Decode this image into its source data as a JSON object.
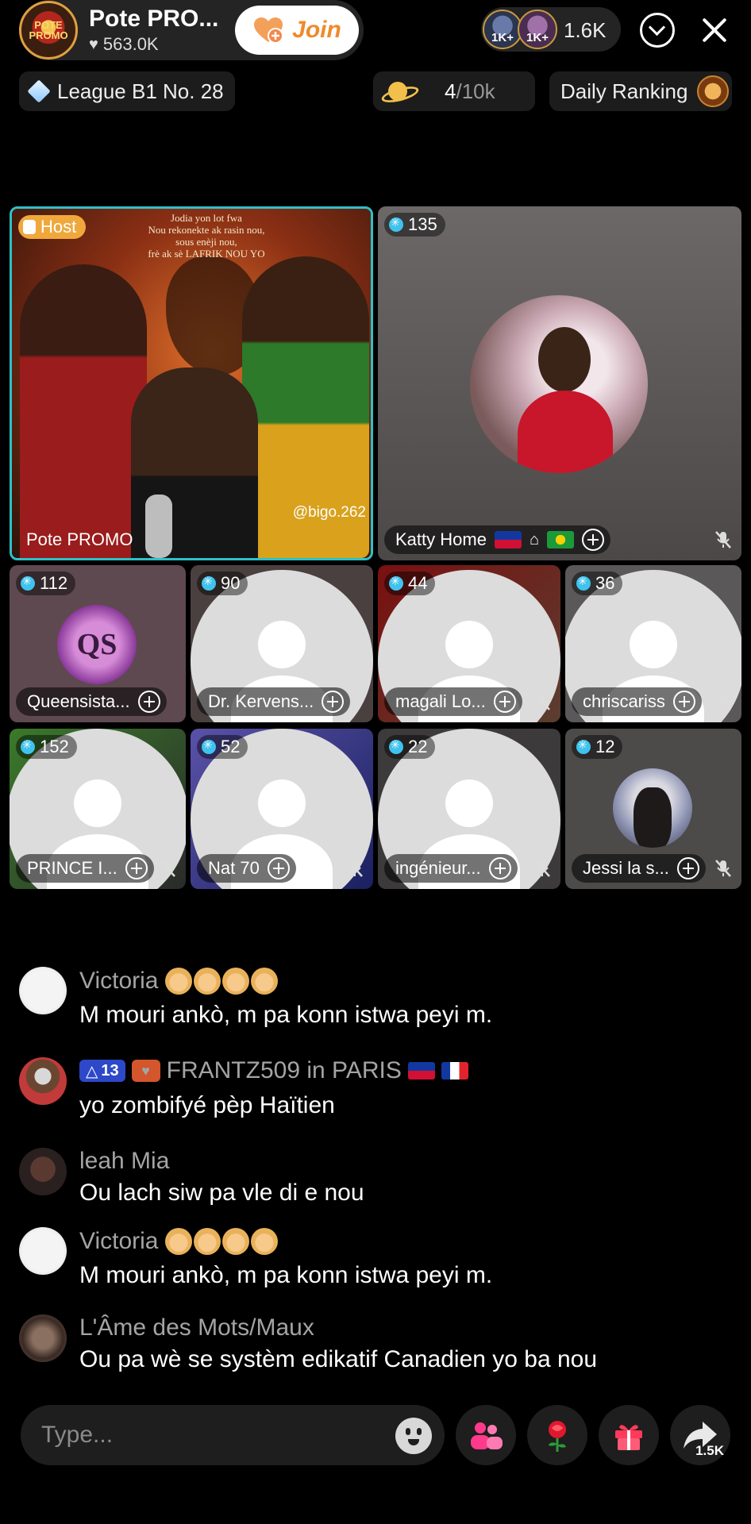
{
  "header": {
    "host_name": "Pote PRO...",
    "host_likes": "563.0K",
    "host_avatar_text": "POTE PROMO",
    "join_label": "Join",
    "viewer_badges": [
      "1K+",
      "1K+"
    ],
    "viewer_count": "1.6K"
  },
  "stats": {
    "league": "League B1 No. 28",
    "planet_value": "4",
    "planet_max": "/10k",
    "ranking": "Daily Ranking"
  },
  "host_seat": {
    "badge": "Host",
    "name": "Pote PROMO",
    "poster_text": "Jodia yon lot fwa\nNou rekonekte ak rasin nou,\nsous enèji nou,\nfrè ak sè LAFRIK NOU YO",
    "watermark": "@bigo.262"
  },
  "seats": [
    {
      "count": "135",
      "name": "Katty Home",
      "muted": true,
      "photo": true
    },
    {
      "count": "112",
      "name": "Queensista...",
      "muted": false,
      "logo": "QS"
    },
    {
      "count": "90",
      "name": "Dr. Kervens...",
      "muted": false
    },
    {
      "count": "44",
      "name": "magali Lo...",
      "muted": true
    },
    {
      "count": "36",
      "name": "chriscariss",
      "muted": true
    },
    {
      "count": "152",
      "name": "PRINCE I...",
      "muted": true
    },
    {
      "count": "52",
      "name": "Nat 70",
      "muted": true
    },
    {
      "count": "22",
      "name": "ingénieur...",
      "muted": true
    },
    {
      "count": "12",
      "name": "Jessi la s...",
      "muted": true
    }
  ],
  "chat": [
    {
      "user": "Victoria",
      "message": "M mouri ankò, m pa konn istwa peyi m."
    },
    {
      "user": "FRANTZ509 in PARIS",
      "level": "13",
      "message": "yo zombifyé pèp Haïtien"
    },
    {
      "user": "leah Mia",
      "message": "Ou lach siw pa vle di e nou"
    },
    {
      "user": "Victoria",
      "message": "M mouri ankò, m pa konn istwa peyi m."
    },
    {
      "user": "L'Âme des Mots/Maux",
      "message": "Ou pa wè se systèm edikatif Canadien yo ba nou"
    }
  ],
  "footer": {
    "input_placeholder": "Type...",
    "share_count": "1.5K"
  },
  "icons": [
    "heart-icon",
    "heart-plus-icon",
    "chevron-down-icon",
    "close-icon",
    "diamond-icon",
    "planet-icon",
    "trophy-icon",
    "mute-icon",
    "plus-icon",
    "emoji-icon",
    "people-icon",
    "rose-icon",
    "gift-icon",
    "share-icon"
  ],
  "colors": {
    "accent_teal": "#2ec0c8",
    "join_orange": "#f08a2a",
    "host_badge": "#f0a83c",
    "level_badge": "#2d48c9"
  }
}
